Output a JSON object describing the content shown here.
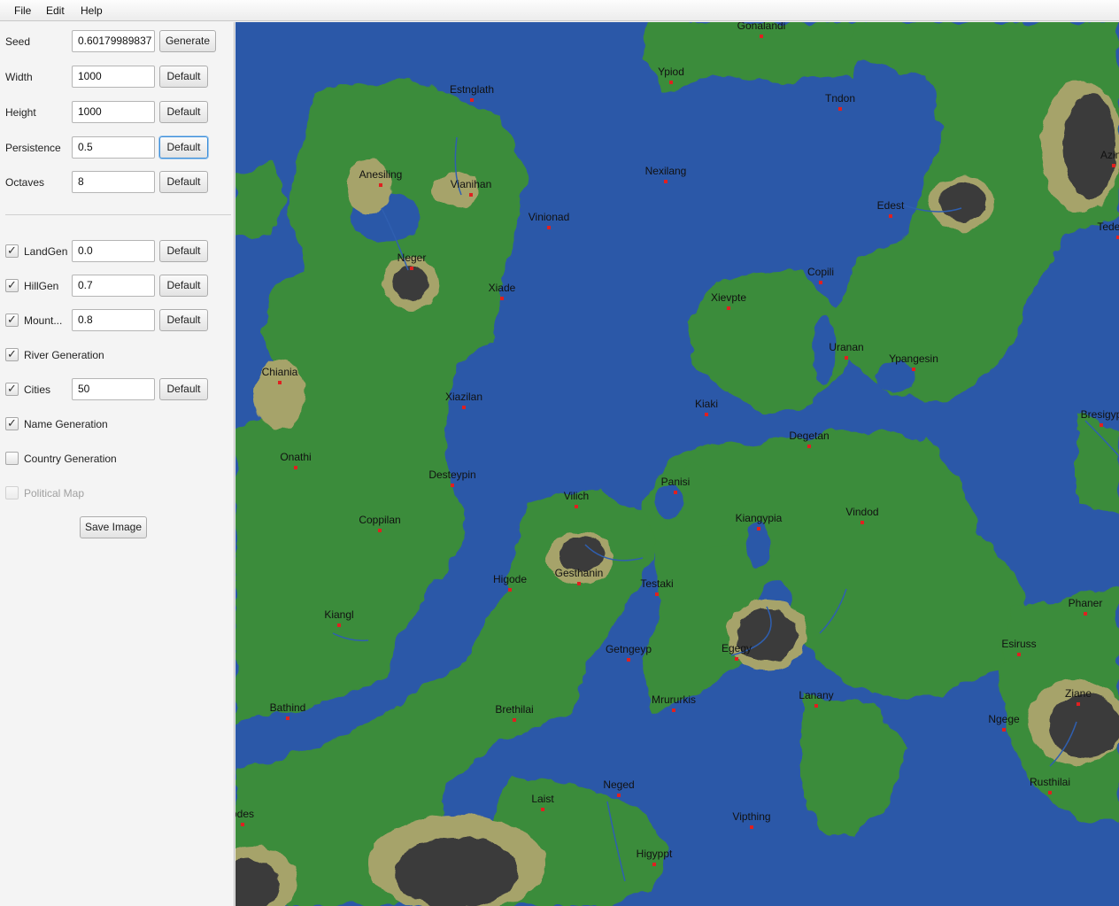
{
  "menu": {
    "file": "File",
    "edit": "Edit",
    "help": "Help"
  },
  "controls": {
    "seed": {
      "label": "Seed",
      "value": "0.60179989837",
      "button": "Generate"
    },
    "width": {
      "label": "Width",
      "value": "1000",
      "button": "Default"
    },
    "height": {
      "label": "Height",
      "value": "1000",
      "button": "Default"
    },
    "persistence": {
      "label": "Persistence",
      "value": "0.5",
      "button": "Default"
    },
    "octaves": {
      "label": "Octaves",
      "value": "8",
      "button": "Default"
    },
    "landgen": {
      "label": "LandGen",
      "checked": true,
      "value": "0.0",
      "button": "Default"
    },
    "hillgen": {
      "label": "HillGen",
      "checked": true,
      "value": "0.7",
      "button": "Default"
    },
    "mountgen": {
      "label": "Mount...",
      "checked": true,
      "value": "0.8",
      "button": "Default"
    },
    "river": {
      "label": "River Generation",
      "checked": true
    },
    "cities": {
      "label": "Cities",
      "checked": true,
      "value": "50",
      "button": "Default"
    },
    "names": {
      "label": "Name Generation",
      "checked": true
    },
    "country": {
      "label": "Country Generation",
      "checked": false
    },
    "political": {
      "label": "Political Map",
      "checked": false,
      "disabled": true
    },
    "save": "Save Image"
  },
  "colors": {
    "water": "#2b58a8",
    "land": "#3b8c3a",
    "hills": "#a6a36a",
    "mountains": "#3a3a3a",
    "city": "#e02020",
    "river": "#2f5fb0"
  },
  "cities": [
    "Gonalandi",
    "Ypiod",
    "Tndon",
    "Azina",
    "Estnglath",
    "Nexilang",
    "Edest",
    "Tedesich",
    "Anesiling",
    "Vianihan",
    "Vinionad",
    "Neger",
    "Xiade",
    "Copili",
    "Xievpte",
    "Uranan",
    "Ypangesin",
    "Chiania",
    "Xiazilan",
    "Kiaki",
    "Degetan",
    "Bresigyp",
    "Onathi",
    "Desteypin",
    "Panisi",
    "Vilich",
    "Kiangypia",
    "Vindod",
    "Coppilan",
    "Higode",
    "Gesthanin",
    "Testaki",
    "Phaner",
    "Kiangl",
    "Getngeyp",
    "Egegy",
    "Esiruss",
    "Ziane",
    "Bathind",
    "Brethilai",
    "Mrururkis",
    "Lanany",
    "Ngege",
    "Rusthilai",
    "Neged",
    "Laist",
    "Vipthing",
    "odes",
    "Higyppt"
  ]
}
